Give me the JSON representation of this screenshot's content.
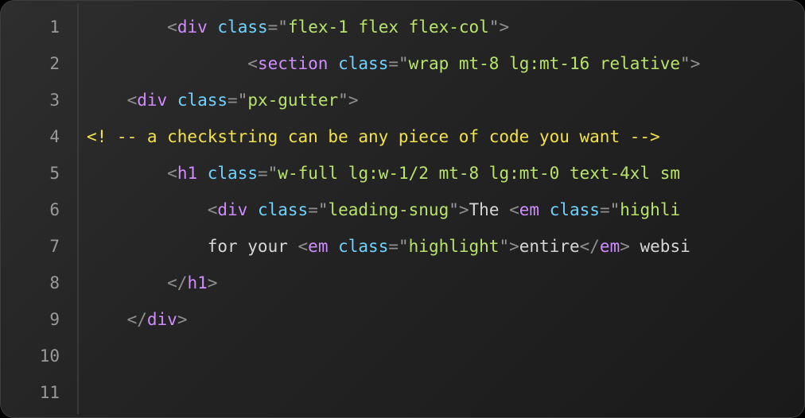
{
  "editor": {
    "line_count": 11,
    "line_numbers": [
      "1",
      "2",
      "3",
      "4",
      "5",
      "6",
      "7",
      "8",
      "9",
      "10",
      "11"
    ],
    "lines": [
      {
        "indent": "        ",
        "tokens": [
          {
            "t": "pun",
            "v": "<"
          },
          {
            "t": "tag",
            "v": "div"
          },
          {
            "t": "txt",
            "v": " "
          },
          {
            "t": "attr",
            "v": "class"
          },
          {
            "t": "eq",
            "v": "="
          },
          {
            "t": "qt",
            "v": "\""
          },
          {
            "t": "str",
            "v": "flex-1 flex flex-col"
          },
          {
            "t": "qt",
            "v": "\""
          },
          {
            "t": "pun",
            "v": ">"
          }
        ]
      },
      {
        "indent": "                ",
        "tokens": [
          {
            "t": "pun",
            "v": "<"
          },
          {
            "t": "tag",
            "v": "section"
          },
          {
            "t": "txt",
            "v": " "
          },
          {
            "t": "attr",
            "v": "class"
          },
          {
            "t": "eq",
            "v": "="
          },
          {
            "t": "qt",
            "v": "\""
          },
          {
            "t": "str",
            "v": "wrap mt-8 lg:mt-16 relative"
          },
          {
            "t": "qt",
            "v": "\""
          },
          {
            "t": "pun",
            "v": ">"
          }
        ]
      },
      {
        "indent": "    ",
        "tokens": [
          {
            "t": "pun",
            "v": "<"
          },
          {
            "t": "tag",
            "v": "div"
          },
          {
            "t": "txt",
            "v": " "
          },
          {
            "t": "attr",
            "v": "class"
          },
          {
            "t": "eq",
            "v": "="
          },
          {
            "t": "qt",
            "v": "\""
          },
          {
            "t": "str",
            "v": "px-gutter"
          },
          {
            "t": "qt",
            "v": "\""
          },
          {
            "t": "pun",
            "v": ">"
          }
        ]
      },
      {
        "indent": "",
        "tokens": [
          {
            "t": "cmt",
            "v": "<! -- a checkstring can be any piece of code you want -->"
          }
        ]
      },
      {
        "indent": "        ",
        "tokens": [
          {
            "t": "pun",
            "v": "<"
          },
          {
            "t": "tag",
            "v": "h1"
          },
          {
            "t": "txt",
            "v": " "
          },
          {
            "t": "attr",
            "v": "class"
          },
          {
            "t": "eq",
            "v": "="
          },
          {
            "t": "qt",
            "v": "\""
          },
          {
            "t": "str",
            "v": "w-full lg:w-1/2 mt-8 lg:mt-0 text-4xl sm"
          }
        ]
      },
      {
        "indent": "            ",
        "tokens": [
          {
            "t": "pun",
            "v": "<"
          },
          {
            "t": "tag",
            "v": "div"
          },
          {
            "t": "txt",
            "v": " "
          },
          {
            "t": "attr",
            "v": "class"
          },
          {
            "t": "eq",
            "v": "="
          },
          {
            "t": "qt",
            "v": "\""
          },
          {
            "t": "str",
            "v": "leading-snug"
          },
          {
            "t": "qt",
            "v": "\""
          },
          {
            "t": "pun",
            "v": ">"
          },
          {
            "t": "txt",
            "v": "The "
          },
          {
            "t": "pun",
            "v": "<"
          },
          {
            "t": "tag",
            "v": "em"
          },
          {
            "t": "txt",
            "v": " "
          },
          {
            "t": "attr",
            "v": "class"
          },
          {
            "t": "eq",
            "v": "="
          },
          {
            "t": "qt",
            "v": "\""
          },
          {
            "t": "str",
            "v": "highli"
          }
        ]
      },
      {
        "indent": "            ",
        "tokens": [
          {
            "t": "txt",
            "v": "for your "
          },
          {
            "t": "pun",
            "v": "<"
          },
          {
            "t": "tag",
            "v": "em"
          },
          {
            "t": "txt",
            "v": " "
          },
          {
            "t": "attr",
            "v": "class"
          },
          {
            "t": "eq",
            "v": "="
          },
          {
            "t": "qt",
            "v": "\""
          },
          {
            "t": "str",
            "v": "highlight"
          },
          {
            "t": "qt",
            "v": "\""
          },
          {
            "t": "pun",
            "v": ">"
          },
          {
            "t": "txt",
            "v": "entire"
          },
          {
            "t": "pun",
            "v": "</"
          },
          {
            "t": "tag",
            "v": "em"
          },
          {
            "t": "pun",
            "v": ">"
          },
          {
            "t": "txt",
            "v": " websi"
          }
        ]
      },
      {
        "indent": "        ",
        "tokens": [
          {
            "t": "pun",
            "v": "</"
          },
          {
            "t": "tag",
            "v": "h1"
          },
          {
            "t": "pun",
            "v": ">"
          }
        ]
      },
      {
        "indent": "    ",
        "tokens": [
          {
            "t": "pun",
            "v": "</"
          },
          {
            "t": "tag",
            "v": "div"
          },
          {
            "t": "pun",
            "v": ">"
          }
        ]
      },
      {
        "indent": "",
        "tokens": []
      },
      {
        "indent": "",
        "tokens": []
      }
    ]
  }
}
